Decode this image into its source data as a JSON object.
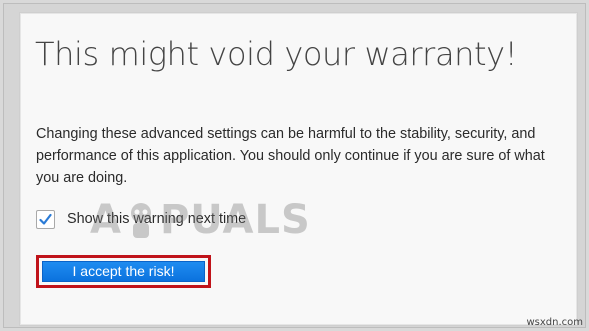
{
  "dialog": {
    "title": "This might void your warranty!",
    "description": "Changing these advanced settings can be harmful to the stability, security, and performance of this application. You should only continue if you are sure of what you are doing.",
    "show_warning_label": "Show this warning next time",
    "show_warning_checked": true,
    "accept_button_label": "I accept the risk!"
  },
  "watermark": {
    "left": "A",
    "right": "PUALS"
  },
  "site_mark": "wsxdn.com",
  "colors": {
    "button": "#1080e8",
    "highlight_border": "#c0131a",
    "checkmark": "#2b7bd6"
  }
}
